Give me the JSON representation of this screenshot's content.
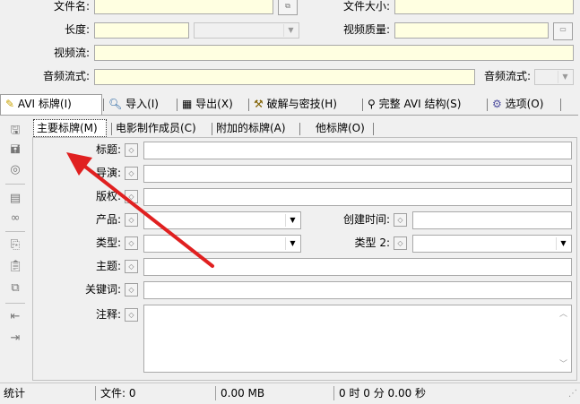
{
  "info": {
    "filename_label": "文件名:",
    "filesize_label": "文件大小:",
    "length_label": "长度:",
    "videoquality_label": "视频质量:",
    "videostream_label": "视频流:",
    "audiostream_label": "音频流式:",
    "audiostream2_label": "音频流式:"
  },
  "tabs": [
    {
      "label": "AVI 标牌(I)",
      "icon": "pencil-icon"
    },
    {
      "label": "导入(I)",
      "icon": "magnifier-icon"
    },
    {
      "label": "导出(X)",
      "icon": "table-icon"
    },
    {
      "label": "破解与密技(H)",
      "icon": "tools-icon"
    },
    {
      "label": "完整 AVI 结构(S)",
      "icon": "search-icon"
    },
    {
      "label": "选项(O)",
      "icon": "options-icon"
    }
  ],
  "subtabs": [
    "主要标牌(M)",
    "电影制作成员(C)",
    "附加的标牌(A)",
    "他标牌(O)"
  ],
  "form": {
    "title_label": "标题:",
    "director_label": "导演:",
    "copyright_label": "版权:",
    "product_label": "产品:",
    "created_label": "创建时间:",
    "type_label": "类型:",
    "type2_label": "类型 2:",
    "subject_label": "主题:",
    "keywords_label": "关键词:",
    "comments_label": "注释:"
  },
  "status": {
    "stats": "统计",
    "files": "文件: 0",
    "size": "0.00 MB",
    "time": "0 时 0 分 0.00 秒"
  },
  "colors": {
    "field_yellow": "#ffffe1",
    "arrow_red": "#e02020"
  }
}
